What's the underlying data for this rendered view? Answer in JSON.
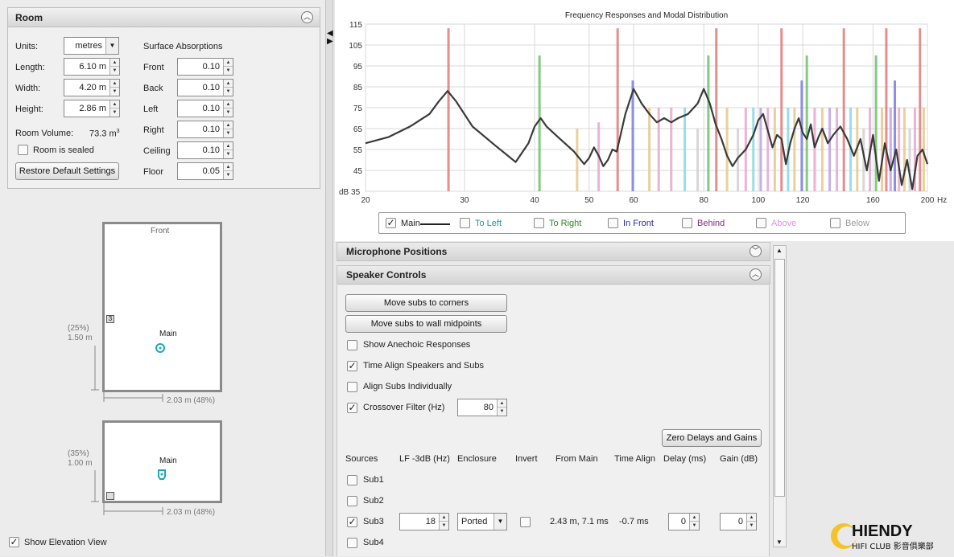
{
  "room": {
    "title": "Room",
    "units_label": "Units:",
    "units_value": "metres",
    "length_label": "Length:",
    "length_value": "6.10 m",
    "width_label": "Width:",
    "width_value": "4.20 m",
    "height_label": "Height:",
    "height_value": "2.86 m",
    "volume_label": "Room Volume:",
    "volume_value": "73.3 m",
    "volume_sup": "3",
    "sealed_label": "Room is sealed",
    "sealed_checked": false,
    "restore_label": "Restore Default Settings",
    "absorption_title": "Surface Absorptions",
    "absorptions": [
      {
        "label": "Front",
        "value": "0.10"
      },
      {
        "label": "Back",
        "value": "0.10"
      },
      {
        "label": "Left",
        "value": "0.10"
      },
      {
        "label": "Right",
        "value": "0.10"
      },
      {
        "label": "Ceiling",
        "value": "0.10"
      },
      {
        "label": "Floor",
        "value": "0.05"
      }
    ]
  },
  "plan": {
    "front_label": "Front",
    "main_label": "Main",
    "sub_marker": "3",
    "top_dim_pct": "(25%)",
    "top_dim_val": "1.50 m",
    "top_dim_width": "2.03 m (48%)",
    "elev_main_label": "Main",
    "elev_dim_pct": "(35%)",
    "elev_dim_val": "1.00 m",
    "elev_dim_width": "2.03 m (48%)",
    "show_elevation_label": "Show Elevation View",
    "show_elevation_checked": true
  },
  "chart_data": {
    "type": "line",
    "title": "Frequency Responses and Modal Distribution",
    "xlabel": "Hz",
    "ylabel": "dB",
    "x_scale": "log",
    "xlim": [
      20,
      200
    ],
    "ylim": [
      35,
      115
    ],
    "x_ticks": [
      20,
      30,
      40,
      50,
      60,
      80,
      100,
      120,
      160,
      200
    ],
    "y_ticks": [
      35,
      45,
      55,
      65,
      75,
      85,
      95,
      105,
      115
    ],
    "grid": true,
    "series": [
      {
        "name": "Main",
        "color": "#3a3a3a",
        "x": [
          20,
          22,
          24,
          26,
          27,
          28,
          29,
          31,
          34,
          37,
          39,
          40,
          41,
          42,
          44,
          47,
          49,
          50,
          51,
          52,
          53,
          54,
          55,
          56,
          58,
          60,
          62,
          64,
          66,
          68,
          70,
          72,
          75,
          78,
          80,
          82,
          84,
          86,
          88,
          90,
          92,
          95,
          98,
          100,
          102,
          104,
          106,
          108,
          110,
          112,
          114,
          116,
          118,
          120,
          122,
          124,
          126,
          128,
          130,
          133,
          136,
          140,
          144,
          148,
          152,
          156,
          160,
          164,
          168,
          172,
          176,
          180,
          184,
          188,
          192,
          196,
          200
        ],
        "values": [
          58,
          61,
          66,
          72,
          78,
          83,
          78,
          66,
          57,
          49,
          58,
          66,
          70,
          66,
          61,
          54,
          48,
          51,
          56,
          52,
          47,
          50,
          55,
          54,
          72,
          84,
          77,
          72,
          68,
          70,
          68,
          70,
          72,
          77,
          84,
          77,
          67,
          60,
          52,
          47,
          51,
          55,
          62,
          69,
          72,
          64,
          56,
          62,
          60,
          48,
          58,
          65,
          70,
          63,
          60,
          67,
          56,
          61,
          65,
          58,
          62,
          66,
          60,
          52,
          60,
          45,
          62,
          40,
          58,
          45,
          55,
          38,
          50,
          36,
          52,
          55,
          48
        ]
      }
    ],
    "modal_lines": [
      {
        "x": 28.1,
        "h": 113,
        "color": "#e07a7a"
      },
      {
        "x": 40.8,
        "h": 100,
        "color": "#6ec06e"
      },
      {
        "x": 47.6,
        "h": 65,
        "color": "#e6c88c"
      },
      {
        "x": 52,
        "h": 68,
        "color": "#e6a7cc"
      },
      {
        "x": 56.2,
        "h": 113,
        "color": "#e07a7a"
      },
      {
        "x": 59.8,
        "h": 88,
        "color": "#7a7ae0"
      },
      {
        "x": 64,
        "h": 75,
        "color": "#e6c88c"
      },
      {
        "x": 66.5,
        "h": 75,
        "color": "#e6a7cc"
      },
      {
        "x": 70,
        "h": 75,
        "color": "#e6a7cc"
      },
      {
        "x": 74,
        "h": 75,
        "color": "#88d8e0"
      },
      {
        "x": 78,
        "h": 65,
        "color": "#d0d0d0"
      },
      {
        "x": 81.5,
        "h": 100,
        "color": "#6ec06e"
      },
      {
        "x": 84.2,
        "h": 113,
        "color": "#e07a7a"
      },
      {
        "x": 88,
        "h": 75,
        "color": "#e6c88c"
      },
      {
        "x": 92,
        "h": 65,
        "color": "#d0d0d0"
      },
      {
        "x": 95,
        "h": 75,
        "color": "#e6a7cc"
      },
      {
        "x": 98,
        "h": 75,
        "color": "#88d8e0"
      },
      {
        "x": 101,
        "h": 75,
        "color": "#c0a0e0"
      },
      {
        "x": 104,
        "h": 75,
        "color": "#e6a7cc"
      },
      {
        "x": 107,
        "h": 75,
        "color": "#e6c88c"
      },
      {
        "x": 110,
        "h": 113,
        "color": "#e07a7a"
      },
      {
        "x": 113,
        "h": 75,
        "color": "#88d8e0"
      },
      {
        "x": 116,
        "h": 75,
        "color": "#e6c88c"
      },
      {
        "x": 119.5,
        "h": 88,
        "color": "#7a7ae0"
      },
      {
        "x": 122,
        "h": 100,
        "color": "#6ec06e"
      },
      {
        "x": 126,
        "h": 75,
        "color": "#e6a7cc"
      },
      {
        "x": 130,
        "h": 75,
        "color": "#e6c88c"
      },
      {
        "x": 134,
        "h": 75,
        "color": "#c0a0e0"
      },
      {
        "x": 138,
        "h": 75,
        "color": "#e6a7cc"
      },
      {
        "x": 142,
        "h": 113,
        "color": "#e07a7a"
      },
      {
        "x": 146,
        "h": 75,
        "color": "#88d8e0"
      },
      {
        "x": 150,
        "h": 75,
        "color": "#e6c88c"
      },
      {
        "x": 154,
        "h": 65,
        "color": "#d0d0d0"
      },
      {
        "x": 158,
        "h": 75,
        "color": "#e6a7cc"
      },
      {
        "x": 162,
        "h": 100,
        "color": "#6ec06e"
      },
      {
        "x": 166,
        "h": 75,
        "color": "#e6c88c"
      },
      {
        "x": 169,
        "h": 113,
        "color": "#e07a7a"
      },
      {
        "x": 172,
        "h": 75,
        "color": "#c0a0e0"
      },
      {
        "x": 175,
        "h": 88,
        "color": "#7a7ae0"
      },
      {
        "x": 178,
        "h": 75,
        "color": "#e6a7cc"
      },
      {
        "x": 182,
        "h": 75,
        "color": "#e6c88c"
      },
      {
        "x": 186,
        "h": 65,
        "color": "#d0d0d0"
      },
      {
        "x": 190,
        "h": 75,
        "color": "#e6a7cc"
      },
      {
        "x": 194,
        "h": 113,
        "color": "#e07a7a"
      },
      {
        "x": 197,
        "h": 75,
        "color": "#e6c88c"
      }
    ]
  },
  "legend": [
    {
      "label": "Main",
      "color": "#222222",
      "checked": true
    },
    {
      "label": "To Left",
      "color": "#1a9a9a",
      "checked": false
    },
    {
      "label": "To Right",
      "color": "#2a8a2a",
      "checked": false
    },
    {
      "label": "In Front",
      "color": "#2a2aaa",
      "checked": false
    },
    {
      "label": "Behind",
      "color": "#8a2a8a",
      "checked": false
    },
    {
      "label": "Above",
      "color": "#e090e0",
      "checked": false
    },
    {
      "label": "Below",
      "color": "#9a9a9a",
      "checked": false
    }
  ],
  "mic_positions_title": "Microphone Positions",
  "speaker_controls": {
    "title": "Speaker Controls",
    "move_corners": "Move subs to corners",
    "move_midpoints": "Move subs to wall midpoints",
    "show_anechoic": "Show Anechoic Responses",
    "show_anechoic_checked": false,
    "time_align": "Time Align Speakers and Subs",
    "time_align_checked": true,
    "align_individually": "Align Subs Individually",
    "align_individually_checked": false,
    "crossover": "Crossover Filter (Hz)",
    "crossover_checked": true,
    "crossover_value": "80",
    "zero_delays": "Zero Delays and Gains",
    "columns": [
      "Sources",
      "LF -3dB (Hz)",
      "Enclosure",
      "Invert",
      "From Main",
      "Time Align",
      "Delay (ms)",
      "Gain (dB)"
    ],
    "subs": [
      {
        "name": "Sub1",
        "checked": false
      },
      {
        "name": "Sub2",
        "checked": false
      },
      {
        "name": "Sub3",
        "checked": true,
        "lf": "18",
        "enclosure": "Ported",
        "from_main": "2.43 m, 7.1 ms",
        "time_align": "-0.7 ms",
        "delay": "0",
        "gain": "0"
      },
      {
        "name": "Sub4",
        "checked": false
      }
    ]
  },
  "logo": {
    "text": "HIENDY",
    "subtitle": "HIFI CLUB 影音俱樂部"
  }
}
